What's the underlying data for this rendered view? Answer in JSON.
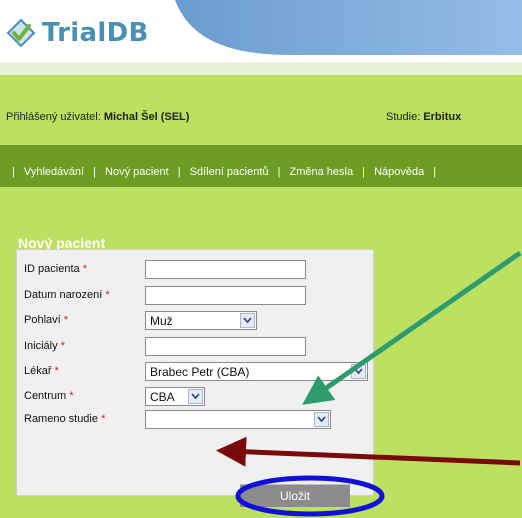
{
  "app": {
    "logo_text": "TrialDB"
  },
  "userbar": {
    "user_label": "Přihlášený uživatel:",
    "user_name": "Michal Šel (SEL)",
    "study_label": "Studie:",
    "study_name": "Erbitux"
  },
  "nav": {
    "sep": "|",
    "items": [
      {
        "label": "Vyhledávání"
      },
      {
        "label": "Nový pacient"
      },
      {
        "label": "Sdílení pacientů"
      },
      {
        "label": "Změna hesla"
      },
      {
        "label": "Nápověda"
      }
    ]
  },
  "form": {
    "title": "Nový pacient",
    "required_mark": "*",
    "fields": {
      "patient_id": {
        "label": "ID pacienta",
        "value": ""
      },
      "birth_date": {
        "label": "Datum narození",
        "value": ""
      },
      "sex": {
        "label": "Pohlaví",
        "value": "Muž"
      },
      "initials": {
        "label": "Iniciály",
        "value": ""
      },
      "doctor": {
        "label": "Lékař",
        "value": "Brabec Petr (CBA)"
      },
      "center": {
        "label": "Centrum",
        "value": "CBA"
      },
      "arm": {
        "label": "Rameno studie",
        "value": ""
      }
    },
    "save_label": "Uložit"
  },
  "colors": {
    "green_bg": "#bde060",
    "nav_green": "#6c9d22",
    "header_blue": "#4a8fb6",
    "required_red": "#d02020",
    "arrow_green": "#2e9b6e",
    "arrow_darkred": "#7a0a0a",
    "highlight_blue": "#1010d8"
  }
}
